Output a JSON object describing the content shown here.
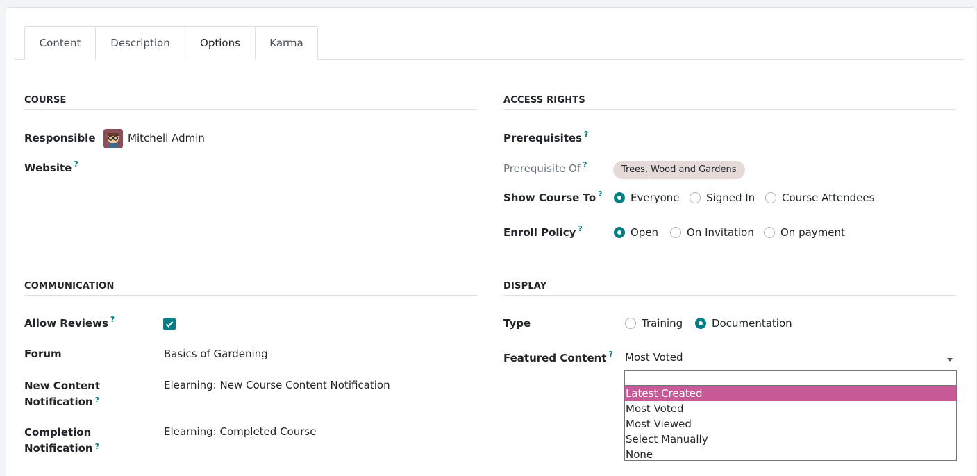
{
  "tabs": [
    {
      "label": "Content"
    },
    {
      "label": "Description"
    },
    {
      "label": "Options"
    },
    {
      "label": "Karma"
    }
  ],
  "course": {
    "section_title": "COURSE",
    "responsible_label": "Responsible",
    "responsible_value": "Mitchell Admin",
    "website_label": "Website",
    "help_mark": "?"
  },
  "access": {
    "section_title": "ACCESS RIGHTS",
    "prerequisites_label": "Prerequisites",
    "prerequisite_of_label": "Prerequisite Of",
    "prerequisite_of_tag": "Trees, Wood and Gardens",
    "show_course_label": "Show Course To",
    "show_course_options": [
      {
        "label": "Everyone",
        "selected": true
      },
      {
        "label": "Signed In",
        "selected": false
      },
      {
        "label": "Course Attendees",
        "selected": false
      }
    ],
    "enroll_label": "Enroll Policy",
    "enroll_options": [
      {
        "label": "Open",
        "selected": true
      },
      {
        "label": "On Invitation",
        "selected": false
      },
      {
        "label": "On payment",
        "selected": false
      }
    ]
  },
  "communication": {
    "section_title": "COMMUNICATION",
    "allow_reviews_label": "Allow Reviews",
    "allow_reviews_checked": true,
    "forum_label": "Forum",
    "forum_value": "Basics of Gardening",
    "new_content_label_1": "New Content",
    "new_content_label_2": "Notification",
    "new_content_value": "Elearning: New Course Content Notification",
    "completion_label_1": "Completion",
    "completion_label_2": "Notification",
    "completion_value": "Elearning: Completed Course"
  },
  "display": {
    "section_title": "DISPLAY",
    "type_label": "Type",
    "type_options": [
      {
        "label": "Training",
        "selected": false
      },
      {
        "label": "Documentation",
        "selected": true
      }
    ],
    "featured_label": "Featured Content",
    "featured_value": "Most Voted",
    "featured_options": [
      "Latest Created",
      "Most Voted",
      "Most Viewed",
      "Select Manually",
      "None"
    ],
    "featured_highlighted": "Latest Created"
  },
  "colors": {
    "accent": "#017e84",
    "highlight": "#c75a97",
    "tag_bg": "#e6dad8"
  }
}
